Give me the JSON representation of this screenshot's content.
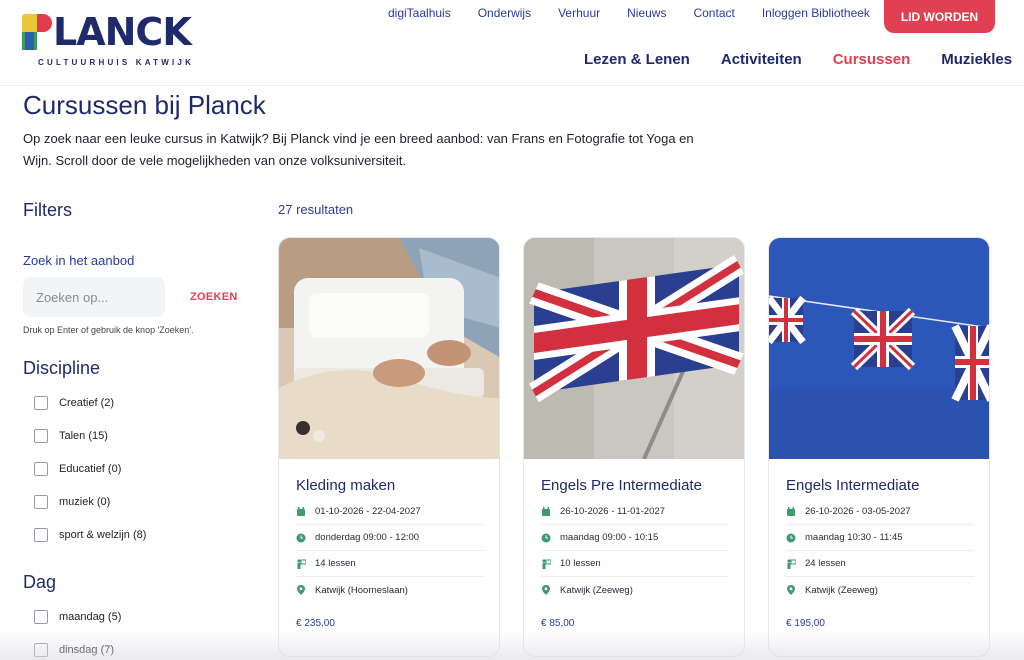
{
  "logo": {
    "name": "PLANCK",
    "name_rest": "LANCK",
    "subtitle": "CULTUURHUIS KATWIJK"
  },
  "topnav": [
    "digiTaalhuis",
    "Onderwijs",
    "Verhuur",
    "Nieuws",
    "Contact",
    "Inloggen Bibliotheek"
  ],
  "lid_button": "LID WORDEN",
  "mainnav": [
    {
      "label": "Lezen & Lenen"
    },
    {
      "label": "Activiteiten"
    },
    {
      "label": "Cursussen",
      "active": true
    },
    {
      "label": "Muziekles"
    }
  ],
  "page": {
    "title": "Cursussen bij Planck",
    "intro": "Op zoek naar een leuke cursus in Katwijk? Bij Planck vind je een breed aanbod: van Frans en Fotografie tot Yoga en Wijn. Scroll door de vele mogelijkheden van onze volksuniversiteit."
  },
  "filters": {
    "title": "Filters",
    "search_label": "Zoek in het aanbod",
    "search_placeholder": "Zoeken op...",
    "search_button": "ZOEKEN",
    "hint": "Druk op Enter of gebruik de knop 'Zoeken'.",
    "discipline": {
      "title": "Discipline",
      "options": [
        "Creatief (2)",
        "Talen (15)",
        "Educatief (0)",
        "muziek (0)",
        "sport & welzijn (8)"
      ]
    },
    "dag": {
      "title": "Dag",
      "options": [
        "maandag (5)",
        "dinsdag (7)"
      ]
    }
  },
  "results": {
    "count": "27 resultaten",
    "cards": [
      {
        "title": "Kleding maken",
        "dates": "01-10-2026 - 22-04-2027",
        "time": "donderdag 09:00 - 12:00",
        "lessons": "14 lessen",
        "location": "Katwijk (Hoorneslaan)",
        "price": "€ 235,00"
      },
      {
        "title": "Engels Pre Intermediate",
        "dates": "26-10-2026 - 11-01-2027",
        "time": "maandag 09:00 - 10:15",
        "lessons": "10 lessen",
        "location": "Katwijk (Zeeweg)",
        "price": "€ 85,00"
      },
      {
        "title": "Engels Intermediate",
        "dates": "26-10-2026 - 03-05-2027",
        "time": "maandag 10:30 - 11:45",
        "lessons": "24 lessen",
        "location": "Katwijk (Zeeweg)",
        "price": "€ 195,00"
      }
    ]
  },
  "colors": {
    "brand_blue": "#1f2a6b",
    "accent_red": "#e04052",
    "icon_green": "#3f9a6c"
  },
  "icons": {
    "date": "calendar-icon",
    "time": "clock-icon",
    "lessons": "teacher-icon",
    "location": "map-pin-icon"
  }
}
